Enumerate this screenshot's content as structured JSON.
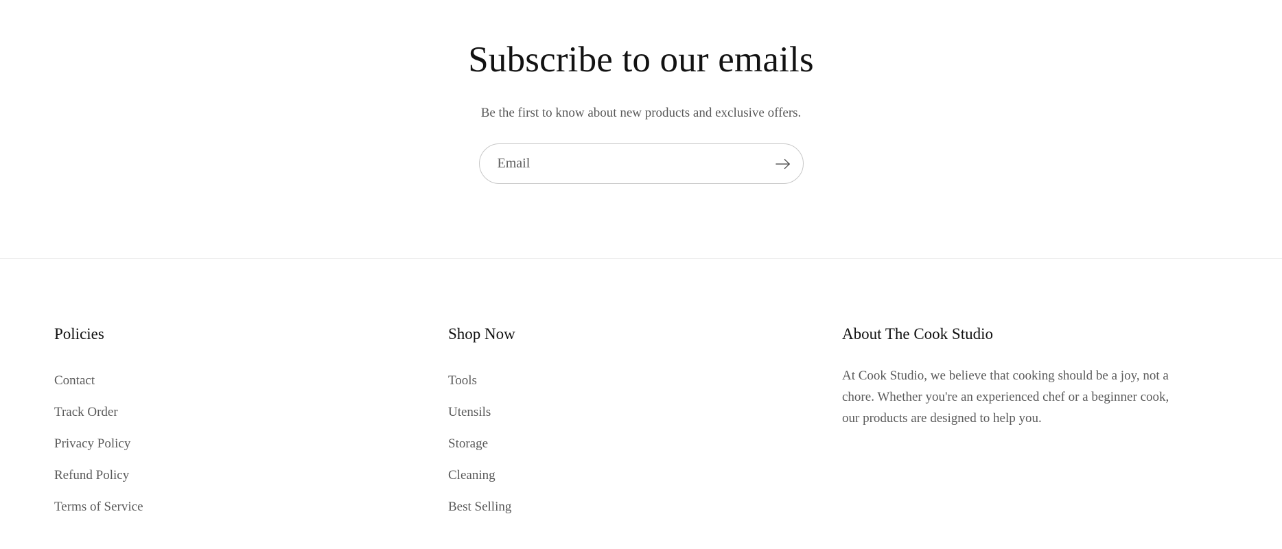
{
  "newsletter": {
    "title": "Subscribe to our emails",
    "subtitle": "Be the first to know about new products and exclusive offers.",
    "email_placeholder": "Email",
    "email_value": "",
    "submit_icon": "arrow-right-icon"
  },
  "footer": {
    "columns": [
      {
        "heading": "Policies",
        "links": [
          "Contact",
          "Track Order",
          "Privacy Policy",
          "Refund Policy",
          "Terms of Service"
        ]
      },
      {
        "heading": "Shop Now",
        "links": [
          "Tools",
          "Utensils",
          "Storage",
          "Cleaning",
          "Best Selling"
        ]
      }
    ],
    "about": {
      "heading": "About The Cook Studio",
      "text": "At Cook Studio, we believe that cooking should be a joy, not a chore. Whether you're an experienced chef or a beginner cook, our products are designed to help you."
    }
  },
  "colors": {
    "background": "#ffffff",
    "heading_text": "#121212",
    "body_text": "#5a5a5a",
    "divider": "#ebebeb",
    "input_border": "#c8c8c8"
  }
}
